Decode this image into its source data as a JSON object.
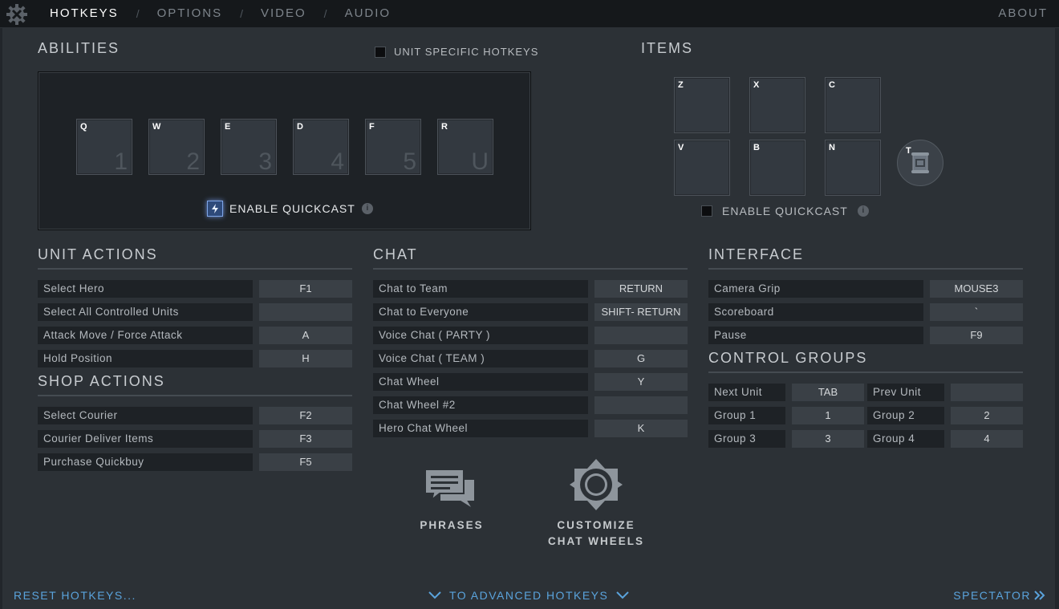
{
  "nav": {
    "tabs": [
      "HOTKEYS",
      "OPTIONS",
      "VIDEO",
      "AUDIO"
    ],
    "separator": "/",
    "about": "ABOUT"
  },
  "abilities": {
    "title": "ABILITIES",
    "unit_specific": "UNIT SPECIFIC HOTKEYS",
    "slots": [
      {
        "key": "Q",
        "num": "1"
      },
      {
        "key": "W",
        "num": "2"
      },
      {
        "key": "E",
        "num": "3"
      },
      {
        "key": "D",
        "num": "4"
      },
      {
        "key": "F",
        "num": "5"
      },
      {
        "key": "R",
        "num": "U"
      }
    ],
    "quickcast": "ENABLE QUICKCAST",
    "info": "i"
  },
  "items": {
    "title": "ITEMS",
    "slots": [
      "Z",
      "X",
      "C",
      "V",
      "B",
      "N"
    ],
    "tp_key": "T",
    "quickcast": "ENABLE QUICKCAST",
    "info": "i"
  },
  "unit_actions": {
    "title": "UNIT ACTIONS",
    "rows": [
      {
        "label": "Select Hero",
        "key": "F1"
      },
      {
        "label": "Select All Controlled Units",
        "key": ""
      },
      {
        "label": "Attack Move / Force Attack",
        "key": "A"
      },
      {
        "label": "Hold Position",
        "key": "H"
      }
    ]
  },
  "shop_actions": {
    "title": "SHOP ACTIONS",
    "rows": [
      {
        "label": "Select Courier",
        "key": "F2"
      },
      {
        "label": "Courier Deliver Items",
        "key": "F3"
      },
      {
        "label": "Purchase Quickbuy",
        "key": "F5"
      }
    ]
  },
  "chat": {
    "title": "CHAT",
    "rows": [
      {
        "label": "Chat to Team",
        "key": "RETURN"
      },
      {
        "label": "Chat to Everyone",
        "key": "SHIFT- RETURN"
      },
      {
        "label": "Voice Chat ( PARTY )",
        "key": ""
      },
      {
        "label": "Voice Chat ( TEAM )",
        "key": "G"
      },
      {
        "label": "Chat Wheel",
        "key": "Y"
      },
      {
        "label": "Chat Wheel #2",
        "key": ""
      },
      {
        "label": "Hero Chat Wheel",
        "key": "K"
      }
    ],
    "phrases": "PHRASES",
    "customize_line1": "CUSTOMIZE",
    "customize_line2": "CHAT WHEELS"
  },
  "interface": {
    "title": "INTERFACE",
    "rows": [
      {
        "label": "Camera Grip",
        "key": "MOUSE3"
      },
      {
        "label": "Scoreboard",
        "key": "`"
      },
      {
        "label": "Pause",
        "key": "F9"
      }
    ]
  },
  "control_groups": {
    "title": "CONTROL GROUPS",
    "rows": [
      {
        "l1": "Next Unit",
        "k1": "TAB",
        "l2": "Prev Unit",
        "k2": ""
      },
      {
        "l1": "Group 1",
        "k1": "1",
        "l2": "Group 2",
        "k2": "2"
      },
      {
        "l1": "Group 3",
        "k1": "3",
        "l2": "Group 4",
        "k2": "4"
      }
    ]
  },
  "footer": {
    "reset": "RESET HOTKEYS...",
    "advanced": "TO ADVANCED HOTKEYS",
    "spectator": "SPECTATOR"
  },
  "colors": {
    "accent": "#5aa3dc",
    "background": "#2c3136"
  }
}
